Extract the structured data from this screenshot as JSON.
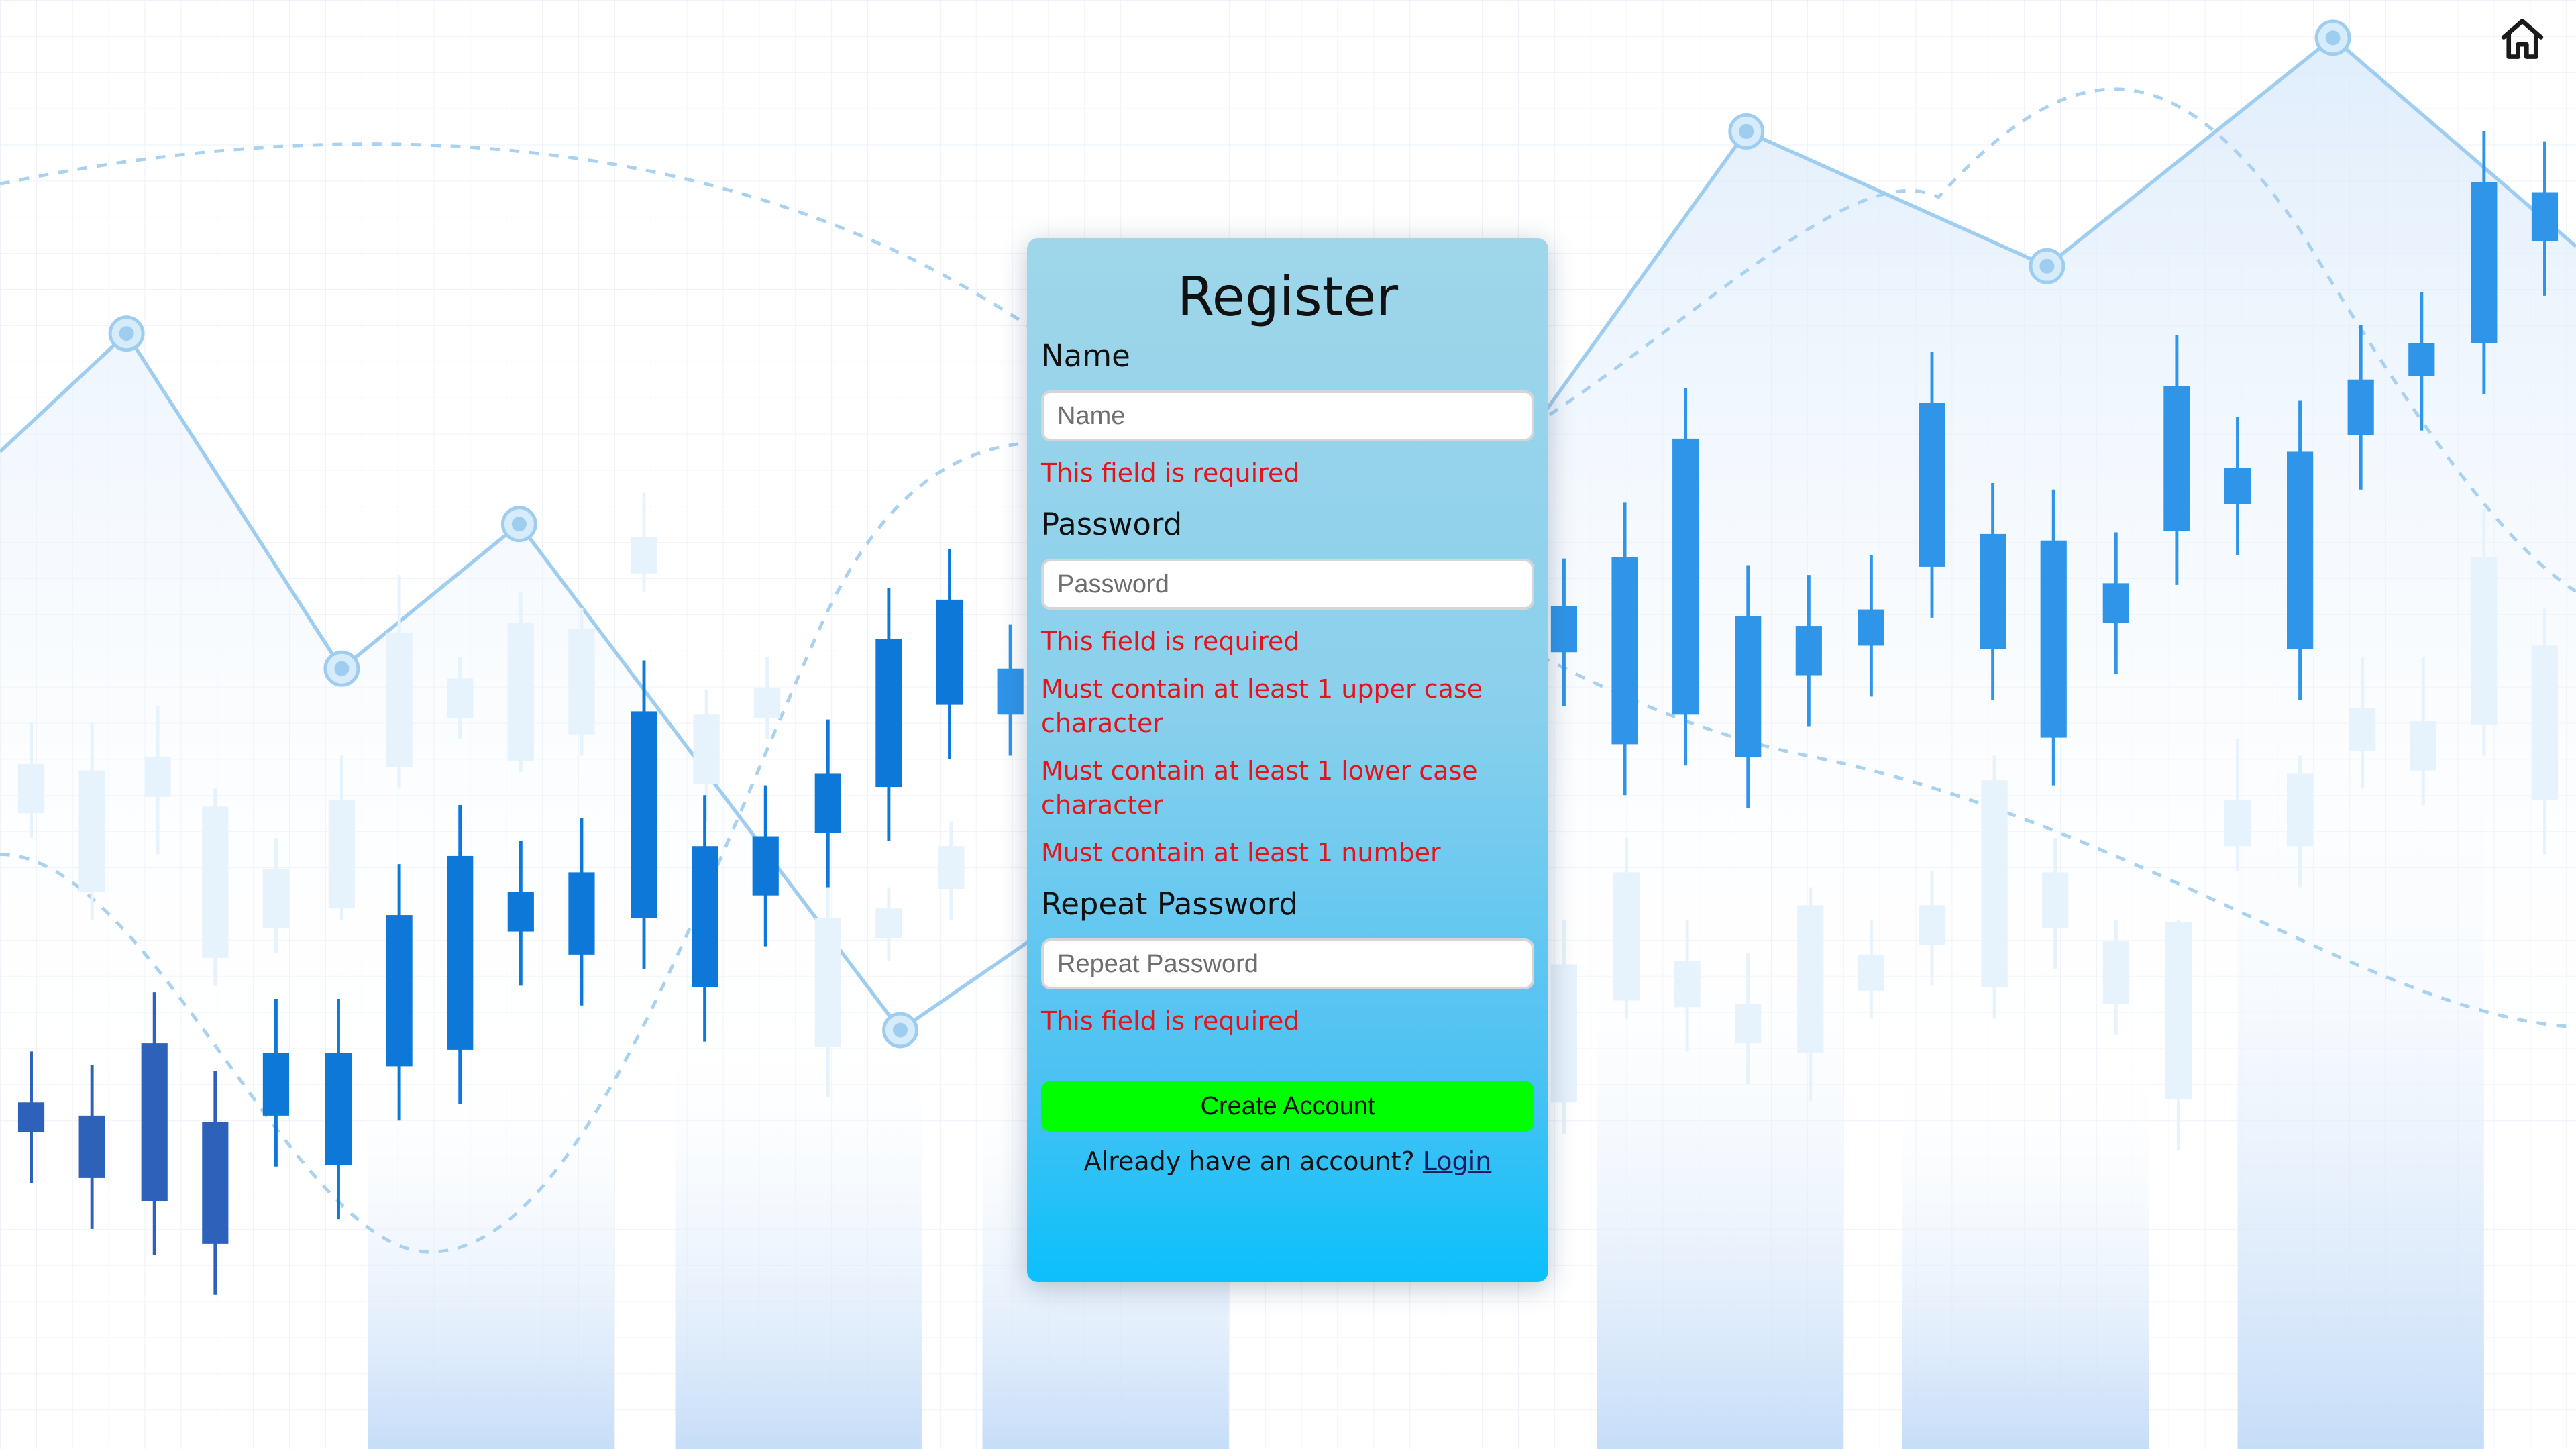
{
  "header": {
    "home_icon": "home-icon"
  },
  "form": {
    "title": "Register",
    "name": {
      "label": "Name",
      "placeholder": "Name",
      "value": "",
      "errors": [
        "This field is required"
      ]
    },
    "password": {
      "label": "Password",
      "placeholder": "Password",
      "value": "",
      "errors": [
        "This field is required",
        "Must contain at least 1 upper case character",
        "Must contain at least 1 lower case character",
        "Must contain at least 1 number"
      ]
    },
    "repeat_password": {
      "label": "Repeat Password",
      "placeholder": "Repeat Password",
      "value": "",
      "errors": [
        "This field is required"
      ]
    },
    "submit_label": "Create Account",
    "already_text": "Already have an account?",
    "login_link": "Login"
  },
  "colors": {
    "error": "#e5141b",
    "submit_bg": "#00ff00",
    "card_top": "#9fd6ea",
    "card_bottom": "#0bc0fb"
  }
}
